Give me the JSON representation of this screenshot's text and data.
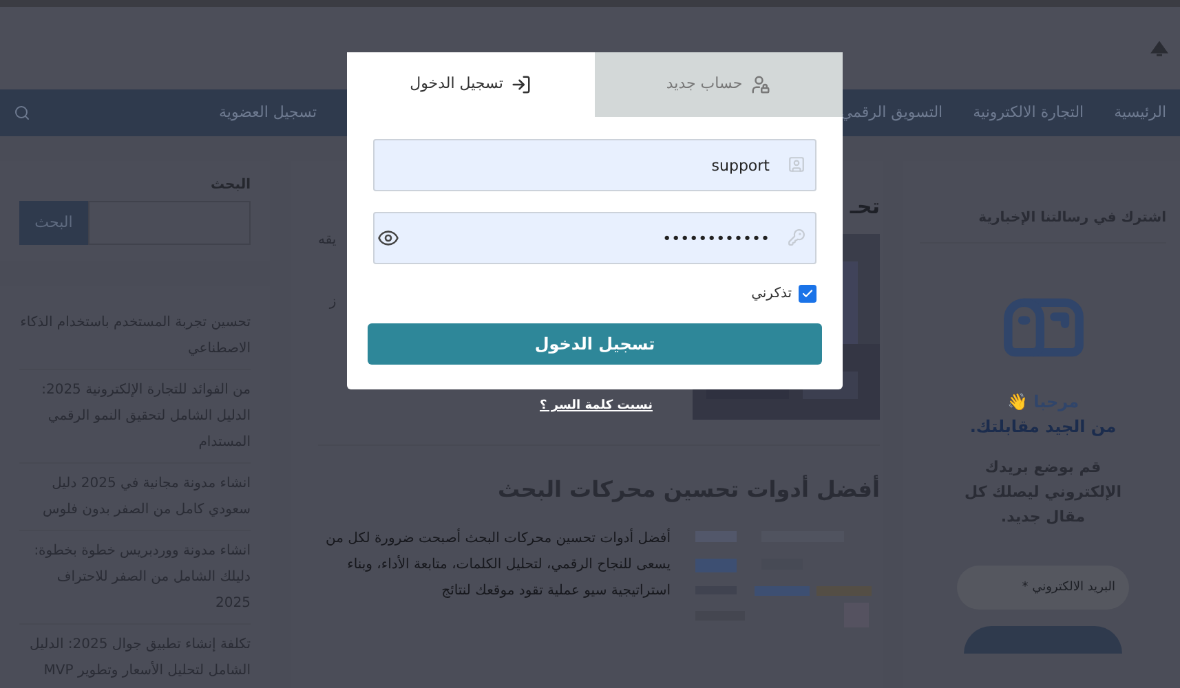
{
  "header": {
    "nav": [
      {
        "label": "الرئيسية"
      },
      {
        "label": "التجارة الالكترونية"
      },
      {
        "label": "التسويق الرقمي"
      },
      {
        "label": "تسجيل العضوية"
      }
    ]
  },
  "sidebar_left": {
    "search_title": "البحث",
    "search_button": "البحث",
    "posts": [
      {
        "title": "تحسين تجربة المستخدم باستخدام الذكاء الاصطناعي"
      },
      {
        "title": "من الفوائد للتجارة الإلكترونية 2025: الدليل الشامل لتحقيق النمو الرقمي المستدام"
      },
      {
        "title": "انشاء مدونة مجانية في 2025 دليل سعودي كامل من الصفر بدون فلوس"
      },
      {
        "title": "انشاء مدونة ووردبريس خطوة بخطوة: دليلك الشامل من الصفر للاحتراف 2025"
      },
      {
        "title": "تكلفة إنشاء تطبيق جوال 2025: الدليل الشامل لتحليل الأسعار وتطوير MVP"
      }
    ]
  },
  "main": {
    "heading_fragment": "تحـ",
    "fragment_1": "يقه",
    "fragment_2": "ز",
    "article": {
      "title": "أفضل أدوات تحسين محركات البحث",
      "excerpt": "أفضل أدوات تحسين محركات البحث أصبحت ضرورة لكل من يسعى للنجاح الرقمي، لتحليل الكلمات، متابعة الأداء، وبناء استراتيجية سيو عملية تقود موقعك لنتائج"
    }
  },
  "sidebar_right": {
    "title": "اشترك في رسالتنا الإخبارية",
    "welcome": "مرحبا 👋",
    "subtitle": "من الجيد مقابلتك.",
    "body": "قم بوضع بريدك الإلكتروني ليصلك كل مقال جديد.",
    "email_placeholder": "البريد الالكتروني *"
  },
  "modal": {
    "tabs": [
      {
        "label": "حساب جديد",
        "selected": false
      },
      {
        "label": "تسجيل الدخول",
        "selected": true
      }
    ],
    "username": "support",
    "password": "••••••••••••",
    "remember": {
      "label": "تذكرني",
      "checked": true
    },
    "submit": "تسجيل الدخول",
    "forgot": "نسيت كلمة السر ؟"
  }
}
